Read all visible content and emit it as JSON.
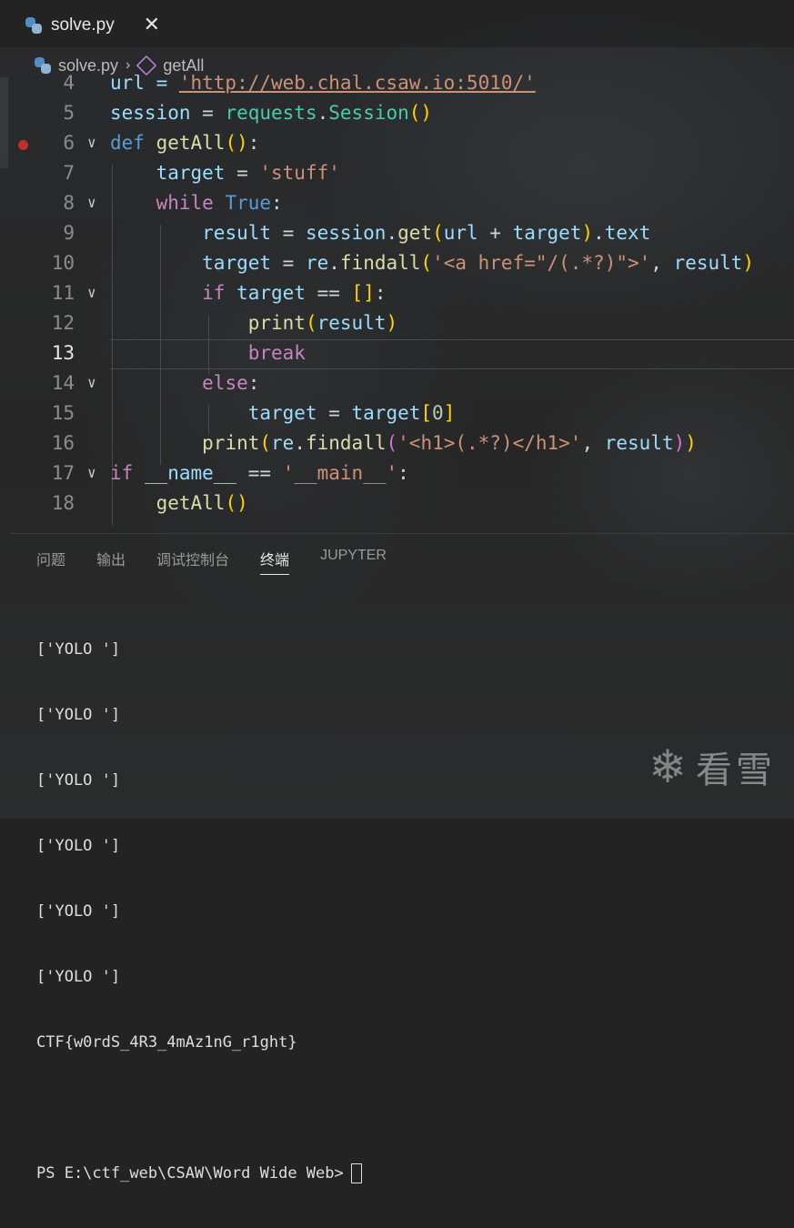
{
  "tab": {
    "label": "solve.py",
    "close": "✕"
  },
  "breadcrumb": {
    "file": "solve.py",
    "separator": "›",
    "symbol": "getAll"
  },
  "editor": {
    "active_line": 13,
    "lines": [
      {
        "n": "4"
      },
      {
        "n": "5"
      },
      {
        "n": "6"
      },
      {
        "n": "7"
      },
      {
        "n": "8"
      },
      {
        "n": "9"
      },
      {
        "n": "10"
      },
      {
        "n": "11"
      },
      {
        "n": "12"
      },
      {
        "n": "13"
      },
      {
        "n": "14"
      },
      {
        "n": "15"
      },
      {
        "n": "16"
      },
      {
        "n": "17"
      },
      {
        "n": "18"
      }
    ],
    "code": {
      "l4_a": "url = ",
      "l4_url": "'http://web.chal.csaw.io:5010/'",
      "l5_a": "session",
      "l5_b": " = ",
      "l5_c": "requests",
      "l5_d": ".",
      "l5_e": "Session",
      "l6_def": "def",
      "l6_name": "getAll",
      "l7_var": "target",
      "l7_eq": " = ",
      "l7_str": "'stuff'",
      "l8_while": "while",
      "l8_true": "True",
      "l8_colon": ":",
      "l9_result": "result",
      "l9_eq": " = ",
      "l9_session": "session",
      "l9_get": "get",
      "l9_url": "url",
      "l9_plus": " + ",
      "l9_target": "target",
      "l9_text": "text",
      "l10_target": "target",
      "l10_eq": " = ",
      "l10_re": "re",
      "l10_findall": "findall",
      "l10_str": "'<a href=\"/(.*?)\">'",
      "l10_comma": ", ",
      "l10_result": "result",
      "l11_if": "if",
      "l11_target": "target",
      "l11_eqeq": " == ",
      "l11_colon": ":",
      "l12_print": "print",
      "l12_result": "result",
      "l13_break": "break",
      "l14_else": "else",
      "l14_colon": ":",
      "l15_target": "target",
      "l15_eq": " = ",
      "l15_target2": "target",
      "l15_zero": "0",
      "l16_print": "print",
      "l16_re": "re",
      "l16_findall": "findall",
      "l16_str": "'<h1>(.*?)</h1>'",
      "l16_comma": ", ",
      "l16_result": "result",
      "l17_if": "if",
      "l17_name": "__name__",
      "l17_eqeq": " == ",
      "l17_str": "'__main__'",
      "l17_colon": ":",
      "l18_call": "getAll"
    }
  },
  "panel": {
    "tabs": [
      "问题",
      "输出",
      "调试控制台",
      "终端",
      "JUPYTER"
    ],
    "active_tab": "终端"
  },
  "terminal": {
    "output": [
      "['YOLO ']",
      "['YOLO ']",
      "['YOLO ']",
      "['YOLO ']",
      "['YOLO ']",
      "['YOLO ']",
      "CTF{w0rdS_4R3_4mAz1nG_r1ght}"
    ],
    "prompt": "PS E:\\ctf_web\\CSAW\\Word Wide Web>"
  },
  "watermark": {
    "icon": "snowflake-icon",
    "text": "看雪"
  }
}
